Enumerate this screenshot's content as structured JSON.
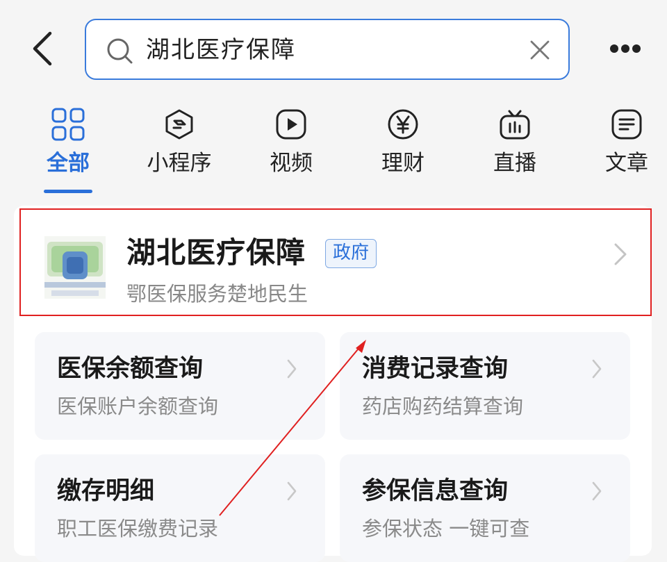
{
  "search": {
    "query": "湖北医疗保障"
  },
  "tabs": [
    {
      "label": "全部",
      "icon": "grid-icon",
      "active": true
    },
    {
      "label": "小程序",
      "icon": "mini-program-icon",
      "active": false
    },
    {
      "label": "视频",
      "icon": "video-play-icon",
      "active": false
    },
    {
      "label": "理财",
      "icon": "yen-coin-icon",
      "active": false
    },
    {
      "label": "直播",
      "icon": "live-tv-icon",
      "active": false
    },
    {
      "label": "文章",
      "icon": "article-icon",
      "active": false
    }
  ],
  "mini_program": {
    "title": "湖北医疗保障",
    "badge": "政府",
    "subtitle": "鄂医保服务楚地民生"
  },
  "services": [
    {
      "title": "医保余额查询",
      "desc": "医保账户余额查询"
    },
    {
      "title": "消费记录查询",
      "desc": "药店购药结算查询"
    },
    {
      "title": "缴存明细",
      "desc": "职工医保缴费记录"
    },
    {
      "title": "参保信息查询",
      "desc": "参保状态 一键可查"
    }
  ],
  "colors": {
    "accent": "#2a6fd9",
    "search_border": "#3a7bdc",
    "highlight_border": "#e02020",
    "annotation_arrow": "#e02020"
  }
}
